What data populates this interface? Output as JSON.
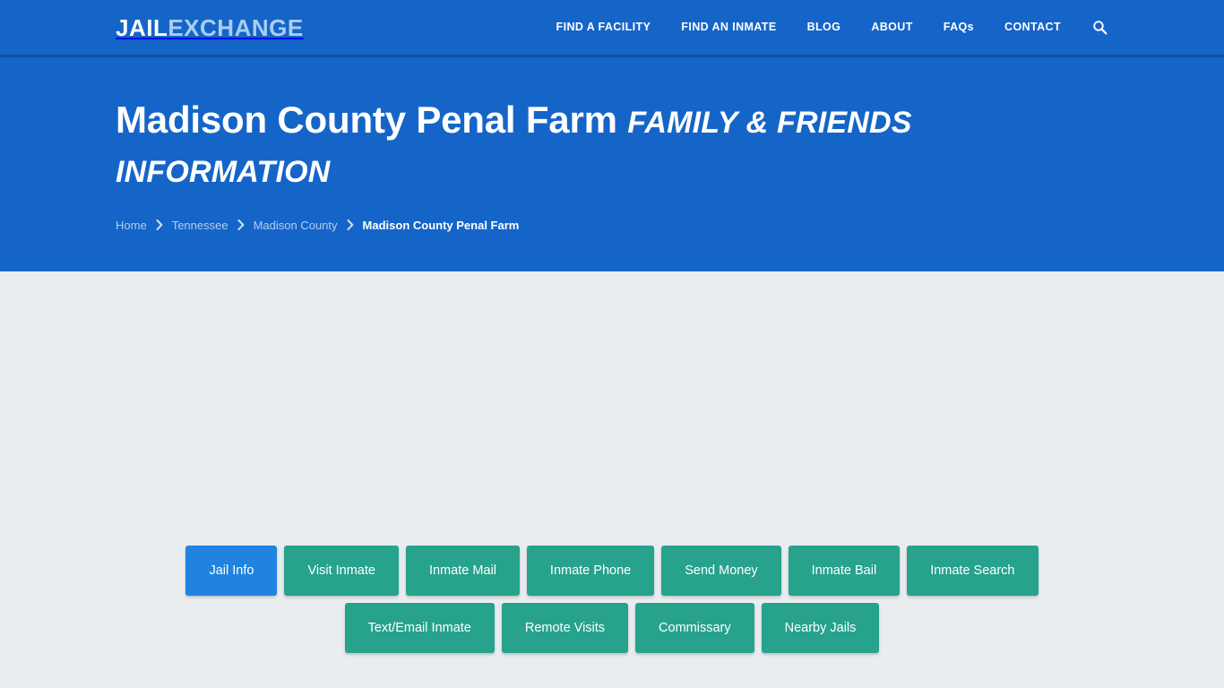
{
  "brand": {
    "part1": "JAIL",
    "part2": "EXCHANGE"
  },
  "nav": {
    "items": [
      {
        "label": "FIND A FACILITY"
      },
      {
        "label": "FIND AN INMATE"
      },
      {
        "label": "BLOG"
      },
      {
        "label": "ABOUT"
      },
      {
        "label": "FAQs"
      },
      {
        "label": "CONTACT"
      }
    ],
    "search_icon": "search-icon"
  },
  "hero": {
    "title_main": "Madison County Penal Farm",
    "title_sub": "FAMILY & FRIENDS INFORMATION",
    "breadcrumb": [
      {
        "label": "Home",
        "current": false
      },
      {
        "label": "Tennessee",
        "current": false
      },
      {
        "label": "Madison County",
        "current": false
      },
      {
        "label": "Madison County Penal Farm",
        "current": true
      }
    ],
    "breadcrumb_separator": "chevron-right-icon"
  },
  "tabs": {
    "row1": [
      {
        "label": "Jail Info",
        "active": true
      },
      {
        "label": "Visit Inmate",
        "active": false
      },
      {
        "label": "Inmate Mail",
        "active": false
      },
      {
        "label": "Inmate Phone",
        "active": false
      },
      {
        "label": "Send Money",
        "active": false
      },
      {
        "label": "Inmate Bail",
        "active": false
      },
      {
        "label": "Inmate Search",
        "active": false
      }
    ],
    "row2": [
      {
        "label": "Text/Email Inmate",
        "active": false
      },
      {
        "label": "Remote Visits",
        "active": false
      },
      {
        "label": "Commissary",
        "active": false
      },
      {
        "label": "Nearby Jails",
        "active": false
      }
    ]
  },
  "colors": {
    "brand_blue": "#1565c8",
    "nav_border": "#1050a0",
    "teal": "#27a28c",
    "active_blue": "#2083e0",
    "body_bg": "#eaedf0",
    "brand_light": "#a9cdf0"
  }
}
